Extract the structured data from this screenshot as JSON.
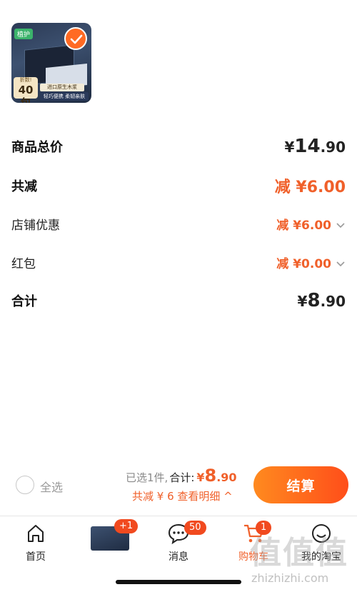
{
  "product": {
    "tag": "植护",
    "pack_small": "折数!",
    "pack_count": "40包",
    "banner_top": "进口原生木浆",
    "banner_bottom": "轻巧便携 柔韧亲肤",
    "selected": true
  },
  "price_rows": {
    "goods_total": {
      "label": "商品总价",
      "yen": "¥",
      "int": "14",
      "dec": ".90"
    },
    "total_reduction": {
      "label": "共减",
      "value": "减 ¥6.00"
    },
    "shop_discount": {
      "label": "店铺优惠",
      "value": "减 ¥6.00"
    },
    "red_packet": {
      "label": "红包",
      "value": "减 ¥0.00"
    },
    "grand_total": {
      "label": "合计",
      "yen": "¥",
      "int": "8",
      "dec": ".90"
    }
  },
  "checkout_bar": {
    "select_all": "全选",
    "selected_count": "已选1件,",
    "total_label": "合计:",
    "amount_yen": "¥",
    "amount_int": "8",
    "amount_dec": ".90",
    "discount_detail": "共减 ¥ 6  查看明细 ^",
    "pay_button": "结算"
  },
  "tabbar": {
    "home": "首页",
    "product_badge": "+1",
    "messages": "消息",
    "messages_badge": "50",
    "cart": "购物车",
    "cart_badge": "1",
    "mine": "我的淘宝"
  },
  "watermark": {
    "main": "值值值",
    "sub": "zhizhizhi.com"
  },
  "colors": {
    "accent": "#f0602a",
    "pay_gradient_start": "#ff8a1f",
    "pay_gradient_end": "#ff4e1a"
  }
}
